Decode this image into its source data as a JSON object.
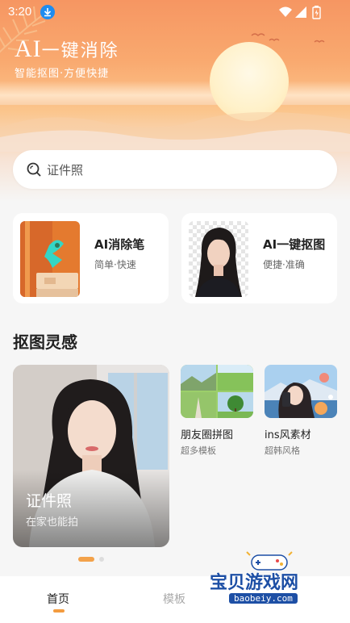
{
  "status_bar": {
    "time": "3:20"
  },
  "hero": {
    "title_ai": "AI",
    "title_rest": "一键消除",
    "subtitle": "智能抠图·方便快捷"
  },
  "search": {
    "placeholder": "证件照"
  },
  "tools": [
    {
      "name": "AI消除笔",
      "desc": "简单·快速"
    },
    {
      "name": "AI一键抠图",
      "desc": "便捷·准确"
    }
  ],
  "inspiration": {
    "title": "抠图灵感",
    "featured": {
      "label": "证件照",
      "sublabel": "在家也能拍"
    },
    "cards": [
      {
        "name": "朋友圈拼图",
        "desc": "超多模板"
      },
      {
        "name": "ins风素材",
        "desc": "超韩风格"
      }
    ]
  },
  "bottom_nav": {
    "home": "首页",
    "templates": "模板"
  },
  "watermark": {
    "text": "宝贝游戏网",
    "url": "baobeiy.com"
  },
  "colors": {
    "accent": "#f39c3f",
    "banner_top": "#f69662",
    "search_bg": "#ffffff"
  }
}
